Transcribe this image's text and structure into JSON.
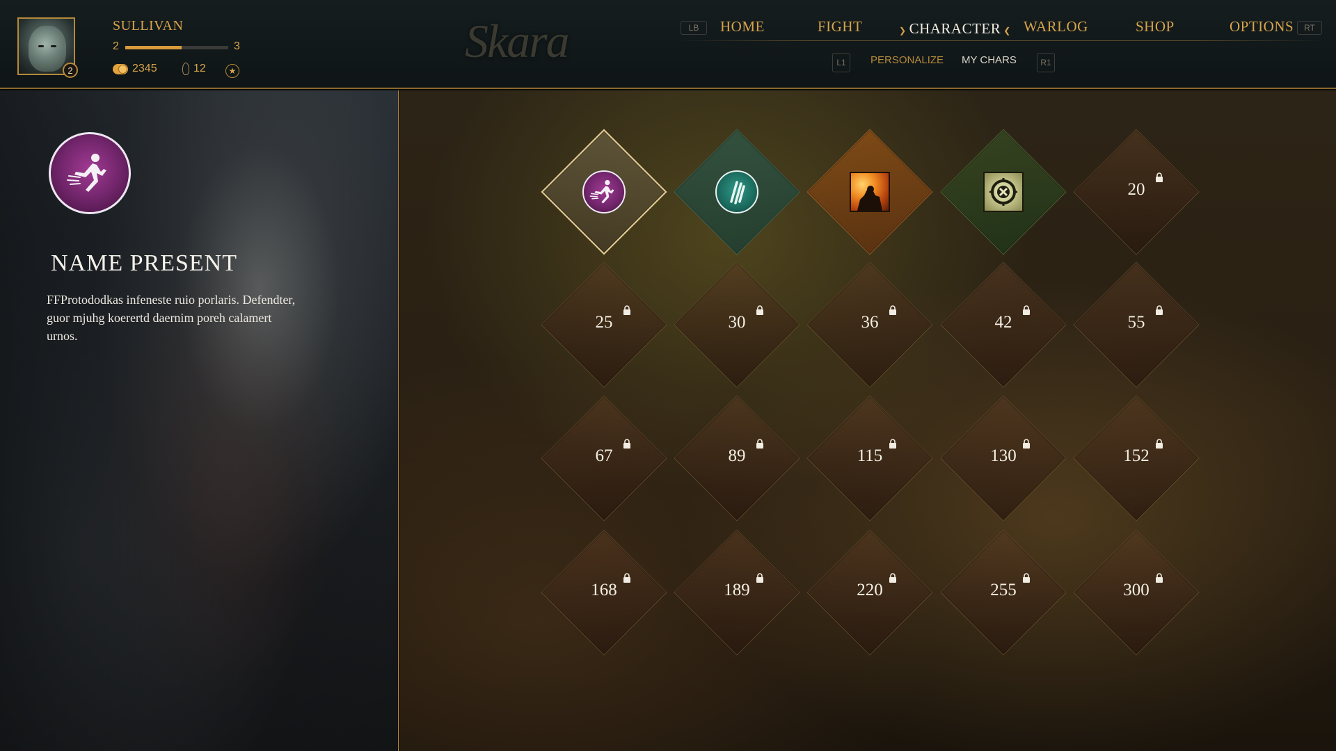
{
  "player": {
    "name": "SULLIVAN",
    "avatar_level": "2",
    "level_current": "2",
    "level_next": "3",
    "xp_progress": 0.55,
    "coins": "2345",
    "gems": "12"
  },
  "logo": "Skara",
  "nav": {
    "home": "HOME",
    "fight": "FIGHT",
    "character": "CHARACTER",
    "warlog": "WARLOG",
    "shop": "SHOP",
    "options": "OPTIONS"
  },
  "controller_hints": {
    "lb": "LB",
    "rt": "RT",
    "l1": "L1",
    "r1": "R1"
  },
  "subnav": {
    "personalize": "PERSONALIZE",
    "my_chars": "MY CHARS"
  },
  "selected_ability": {
    "icon": "dash-runner-icon",
    "title": "NAME PRESENT",
    "description": "FFProtododkas infeneste ruio porlaris. Defendter, guor mjuhg koerertd daernim poreh calamert urnos."
  },
  "colors": {
    "accent_gold": "#d7a44a",
    "purple": "#8a2f80",
    "teal": "#1f7a6c"
  },
  "unlock_grid": {
    "unlocked": [
      {
        "icon": "dash-runner-icon",
        "style": "purple-circle"
      },
      {
        "icon": "claw-slash-icon",
        "style": "teal-circle"
      },
      {
        "icon": "fire-warrior-icon",
        "style": "orange-square"
      },
      {
        "icon": "target-cross-icon",
        "style": "green-square"
      }
    ],
    "locked_levels": [
      "20",
      "25",
      "30",
      "36",
      "42",
      "55",
      "67",
      "89",
      "115",
      "130",
      "152",
      "168",
      "189",
      "220",
      "255",
      "300"
    ]
  }
}
